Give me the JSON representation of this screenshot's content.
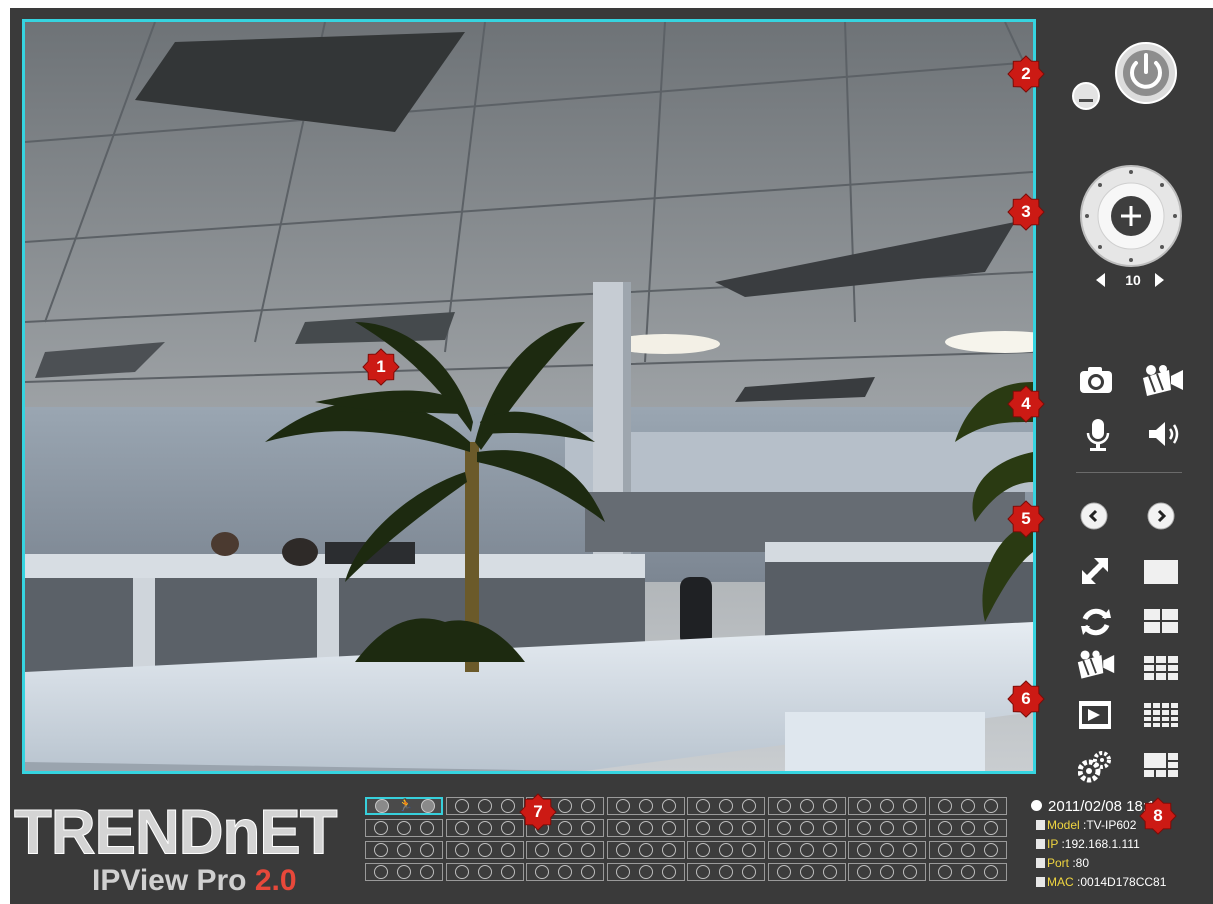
{
  "markers": [
    "1",
    "2",
    "3",
    "4",
    "5",
    "6",
    "7",
    "8"
  ],
  "ptz": {
    "speed_value": "10"
  },
  "icons": {
    "power": "power-icon",
    "minimize": "minimize-icon",
    "ptz": "ptz-joystick-icon",
    "snapshot": "camera-icon",
    "record": "video-record-icon",
    "microphone": "microphone-icon",
    "speaker": "speaker-icon",
    "prev": "chevron-left-icon",
    "next": "chevron-right-icon",
    "fullscreen": "fullscreen-icon",
    "layout1": "layout-1-icon",
    "cycle": "refresh-icon",
    "layout4": "layout-4-icon",
    "record_settings": "record-settings-icon",
    "layout9": "layout-9-icon",
    "playback": "playback-icon",
    "layout16": "layout-16-icon",
    "settings": "gears-icon",
    "layout_custom": "layout-custom-icon"
  },
  "brand": {
    "logo_text": "TRENDnET",
    "product": "IPView Pro ",
    "version": "2.0"
  },
  "status": {
    "datetime": "2011/02/08 18:12",
    "model_label": "Model",
    "model_value": " :TV-IP602",
    "ip_label": "IP",
    "ip_value": " :192.168.1.111",
    "port_label": "Port",
    "port_value": " :80",
    "mac_label": "MAC",
    "mac_value": " :0014D178CC81"
  },
  "channels": {
    "rows": 4,
    "cols": 8,
    "selected": 0,
    "motion_icon": "running-person-icon"
  },
  "colors": {
    "accent": "#36d4e0",
    "marker": "#cc1a14",
    "background": "#3a3a3a",
    "label": "#f0d640"
  }
}
